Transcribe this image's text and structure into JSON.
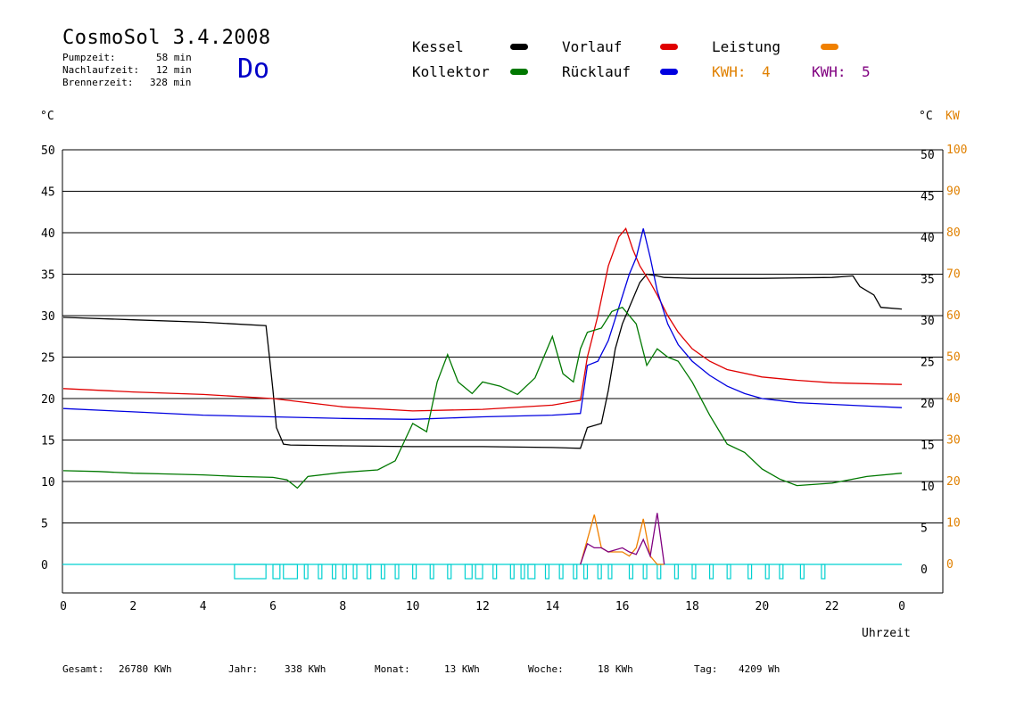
{
  "header": {
    "title": "CosmoSol 3.4.2008",
    "day": "Do",
    "stats": [
      {
        "label": "Pumpzeit:",
        "value": "58 min"
      },
      {
        "label": "Nachlaufzeit:",
        "value": "12 min"
      },
      {
        "label": "Brennerzeit:",
        "value": "328 min"
      }
    ]
  },
  "legend": [
    {
      "label": "Kessel",
      "color": "#000000"
    },
    {
      "label": "Vorlauf",
      "color": "#e00000"
    },
    {
      "label": "Leistung",
      "color": "#f08000"
    },
    {
      "label": "Kollektor",
      "color": "#007800"
    },
    {
      "label": "Rücklauf",
      "color": "#0000e0"
    }
  ],
  "kwh": [
    {
      "label": "KWH:",
      "value": "4",
      "color": "#e08000"
    },
    {
      "label": "KWH:",
      "value": "5",
      "color": "#800080"
    }
  ],
  "footer": [
    {
      "label": "Gesamt:",
      "value": "26780 KWh"
    },
    {
      "label": "Jahr:",
      "value": "338 KWh"
    },
    {
      "label": "Monat:",
      "value": "13 KWh"
    },
    {
      "label": "Woche:",
      "value": "18 KWh"
    },
    {
      "label": "Tag:",
      "value": "4209 Wh"
    }
  ],
  "chart_data": {
    "type": "line",
    "xlabel": "Uhrzeit",
    "ylabel_left": "°C",
    "ylabel_right": "°C",
    "ylabel_right2": "KW",
    "xlim": [
      0,
      24
    ],
    "ylim": [
      0,
      50
    ],
    "y2lim": [
      0,
      100
    ],
    "x_tick_labels": [
      "0",
      "2",
      "4",
      "6",
      "8",
      "10",
      "12",
      "14",
      "16",
      "18",
      "20",
      "22",
      "0"
    ],
    "y_ticks": [
      50,
      45,
      40,
      35,
      30,
      25,
      20,
      15,
      10,
      5,
      0
    ],
    "y2_ticks": [
      100,
      90,
      80,
      70,
      60,
      50,
      40,
      30,
      20,
      10,
      0
    ],
    "grid": true,
    "series": [
      {
        "name": "Kessel",
        "color": "#000000",
        "x": [
          0,
          2,
          4,
          5.8,
          5.9,
          6.0,
          6.1,
          6.3,
          6.5,
          8,
          10,
          12,
          14,
          14.8,
          15.0,
          15.4,
          15.6,
          15.8,
          16.0,
          16.2,
          16.5,
          16.7,
          17.0,
          17.2,
          18,
          20,
          22,
          22.6,
          22.8,
          23.2,
          23.4,
          24
        ],
        "y": [
          29.8,
          29.5,
          29.2,
          28.8,
          25,
          21,
          16.5,
          14.5,
          14.4,
          14.3,
          14.2,
          14.2,
          14.1,
          14.0,
          16.5,
          17,
          21,
          26,
          29,
          31,
          34,
          35,
          34.8,
          34.6,
          34.5,
          34.5,
          34.6,
          34.8,
          33.5,
          32.5,
          31,
          30.8
        ]
      },
      {
        "name": "Vorlauf",
        "color": "#e00000",
        "x": [
          0,
          2,
          4,
          6,
          8,
          10,
          12,
          14,
          14.8,
          15.0,
          15.3,
          15.6,
          15.9,
          16.1,
          16.3,
          16.5,
          16.8,
          17.0,
          17.3,
          17.6,
          18,
          18.5,
          19,
          20,
          21,
          22,
          23,
          24
        ],
        "y": [
          21.2,
          20.8,
          20.5,
          20.0,
          19.0,
          18.5,
          18.7,
          19.2,
          19.8,
          25,
          30,
          36,
          39.5,
          40.5,
          38,
          36,
          34,
          32.5,
          30,
          28,
          26,
          24.5,
          23.5,
          22.6,
          22.2,
          21.9,
          21.8,
          21.7
        ]
      },
      {
        "name": "Rücklauf",
        "color": "#0000e0",
        "x": [
          0,
          2,
          4,
          6,
          8,
          10,
          12,
          14,
          14.8,
          15.0,
          15.3,
          15.6,
          15.9,
          16.2,
          16.4,
          16.6,
          16.8,
          17.0,
          17.3,
          17.6,
          18,
          18.5,
          19,
          19.5,
          20,
          21,
          22,
          23,
          24
        ],
        "y": [
          18.8,
          18.4,
          18.0,
          17.8,
          17.6,
          17.5,
          17.8,
          18.0,
          18.2,
          24,
          24.5,
          27,
          31,
          35,
          37,
          40.5,
          37,
          33,
          29,
          26.5,
          24.5,
          22.8,
          21.5,
          20.6,
          20.0,
          19.5,
          19.3,
          19.1,
          18.9
        ]
      },
      {
        "name": "Kollektor",
        "color": "#007800",
        "x": [
          0,
          1,
          2,
          3,
          4,
          5,
          6,
          6.4,
          6.7,
          7.0,
          8,
          9,
          9.5,
          10,
          10.4,
          10.7,
          11.0,
          11.3,
          11.7,
          12.0,
          12.5,
          13.0,
          13.5,
          14.0,
          14.3,
          14.6,
          14.8,
          15.0,
          15.4,
          15.7,
          16.0,
          16.4,
          16.7,
          17.0,
          17.3,
          17.6,
          18.0,
          18.5,
          19.0,
          19.5,
          20.0,
          20.5,
          21.0,
          22.0,
          23.0,
          24.0
        ],
        "y": [
          11.3,
          11.2,
          11.0,
          10.9,
          10.8,
          10.6,
          10.5,
          10.2,
          9.2,
          10.6,
          11.1,
          11.4,
          12.5,
          17,
          16,
          22,
          25.3,
          22,
          20.6,
          22,
          21.5,
          20.5,
          22.5,
          27.5,
          23,
          22,
          26,
          28,
          28.5,
          30.5,
          31,
          29,
          24,
          26,
          25,
          24.5,
          22,
          18,
          14.5,
          13.5,
          11.5,
          10.3,
          9.5,
          9.8,
          10.6,
          11.0
        ]
      },
      {
        "name": "Leistung",
        "color": "#f08000",
        "x": [
          14.8,
          15.0,
          15.2,
          15.4,
          15.6,
          16.0,
          16.2,
          16.4,
          16.6,
          16.8,
          17.0,
          17.2
        ],
        "y": [
          0,
          3,
          6,
          2,
          1.5,
          1.5,
          1.0,
          2.0,
          5.5,
          1.0,
          0,
          0
        ]
      },
      {
        "name": "KWH 5",
        "color": "#800080",
        "x": [
          14.8,
          15.0,
          15.2,
          15.4,
          15.6,
          16.0,
          16.2,
          16.4,
          16.6,
          16.8,
          17.0,
          17.2
        ],
        "y": [
          0,
          2.5,
          2.0,
          2.0,
          1.5,
          2.0,
          1.5,
          1.2,
          3.0,
          1.0,
          6.2,
          0
        ]
      }
    ]
  }
}
